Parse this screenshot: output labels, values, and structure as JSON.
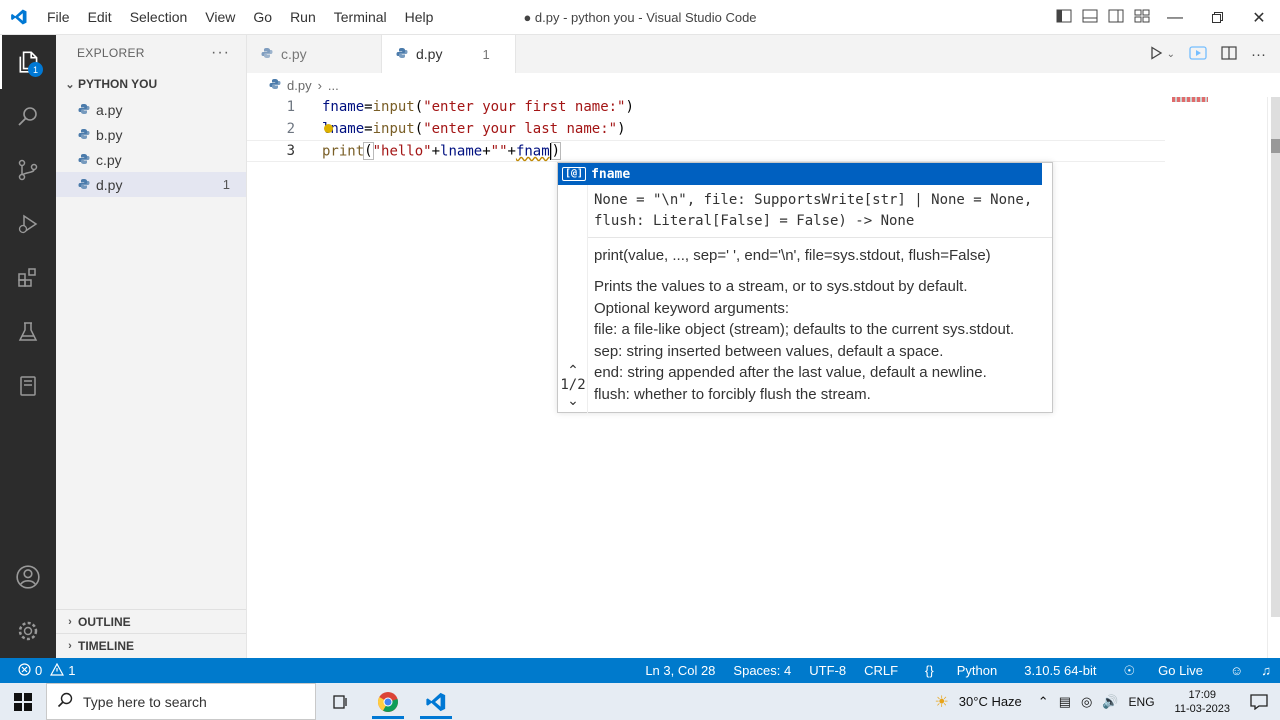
{
  "window": {
    "title": "● d.py - python you - Visual Studio Code"
  },
  "menu": [
    "File",
    "Edit",
    "Selection",
    "View",
    "Go",
    "Run",
    "Terminal",
    "Help"
  ],
  "activity": {
    "explorer_badge": "1"
  },
  "sidebar": {
    "header": "EXPLORER",
    "more": "···",
    "folder": "PYTHON YOU",
    "files": [
      {
        "name": "a.py",
        "problems": ""
      },
      {
        "name": "b.py",
        "problems": ""
      },
      {
        "name": "c.py",
        "problems": ""
      },
      {
        "name": "d.py",
        "problems": "1"
      }
    ],
    "outline": "OUTLINE",
    "timeline": "TIMELINE"
  },
  "tabs": [
    {
      "label": "c.py"
    },
    {
      "label": "d.py",
      "problems": "1"
    }
  ],
  "breadcrumb": {
    "file": "d.py",
    "rest": "..."
  },
  "code": {
    "line_numbers": [
      "1",
      "2",
      "3"
    ],
    "line1": {
      "var": "fname",
      "eq": "=",
      "fn": "input",
      "open": "(",
      "str": "\"enter your first name:\"",
      "close": ")"
    },
    "line2": {
      "var": "lname",
      "eq": "=",
      "fn": "input",
      "open": "(",
      "str": "\"enter your last name:\"",
      "close": ")"
    },
    "line3": {
      "fn": "print",
      "open": "(",
      "str1": "\"hello\"",
      "plus1": "+",
      "var1": "lname",
      "plus2": "+",
      "str2": "\"\"",
      "plus3": "+",
      "partial": "fnam",
      "close": ")"
    }
  },
  "suggest": {
    "item": "fname",
    "item_icon": "[@]",
    "signature_line1": "None = \"\\n\", file: SupportsWrite[str] | None = None,",
    "signature_line2": "flush: Literal[False] = False) -> None",
    "doc_signature": "print(value, ..., sep=' ', end='\\n', file=sys.stdout, flush=False)",
    "doc_lines": [
      "Prints the values to a stream, or to sys.stdout by default.",
      "Optional keyword arguments:",
      "file: a file-like object (stream); defaults to the current sys.stdout.",
      "sep: string inserted between values, default a space.",
      "end: string appended after the last value, default a newline.",
      "flush: whether to forcibly flush the stream."
    ],
    "pager": "1/2"
  },
  "status": {
    "errors": "0",
    "warnings": "1",
    "position": "Ln 3, Col 28",
    "spaces": "Spaces: 4",
    "encoding": "UTF-8",
    "eol": "CRLF",
    "language": "Python",
    "interpreter": "3.10.5 64-bit",
    "golive": "Go Live"
  },
  "taskbar": {
    "search_placeholder": "Type here to search",
    "weather": "30°C  Haze",
    "lang": "ENG",
    "time": "17:09",
    "date": "11-03-2023"
  },
  "colors": {
    "accent": "#007acc",
    "selection": "#0060c0",
    "activity_bg": "#2c2c2c"
  }
}
